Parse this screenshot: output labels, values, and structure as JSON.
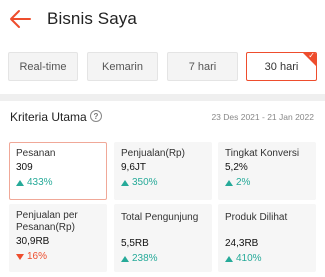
{
  "header": {
    "title": "Bisnis Saya"
  },
  "filters": [
    {
      "label": "Real-time",
      "active": false
    },
    {
      "label": "Kemarin",
      "active": false
    },
    {
      "label": "7 hari",
      "active": false
    },
    {
      "label": "30 hari",
      "active": true
    }
  ],
  "section": {
    "title": "Kriteria Utama",
    "date_range": "23 Des 2021 - 21 Jan 2022"
  },
  "metrics": [
    {
      "label": "Pesanan",
      "value": "309",
      "change": "433%",
      "direction": "up",
      "selected": true
    },
    {
      "label": "Penjualan(Rp)",
      "value": "9,6JT",
      "change": "350%",
      "direction": "up",
      "selected": false
    },
    {
      "label": "Tingkat Konversi",
      "value": "5,2%",
      "change": "2%",
      "direction": "up",
      "selected": false
    },
    {
      "label": "Penjualan per Pesanan(Rp)",
      "value": "30,9RB",
      "change": "16%",
      "direction": "down",
      "selected": false
    },
    {
      "label": "Total Pengunjung",
      "value": "5,5RB",
      "change": "238%",
      "direction": "up",
      "selected": false
    },
    {
      "label": "Produk Dilihat",
      "value": "24,3RB",
      "change": "410%",
      "direction": "up",
      "selected": false
    }
  ],
  "colors": {
    "accent": "#ee4d2d",
    "positive": "#26aa99",
    "negative": "#ee4d2d"
  },
  "icons": {
    "back": "arrow-left-icon",
    "info": "question-circle-icon",
    "check": "check-icon",
    "up": "triangle-up-icon",
    "down": "triangle-down-icon"
  }
}
